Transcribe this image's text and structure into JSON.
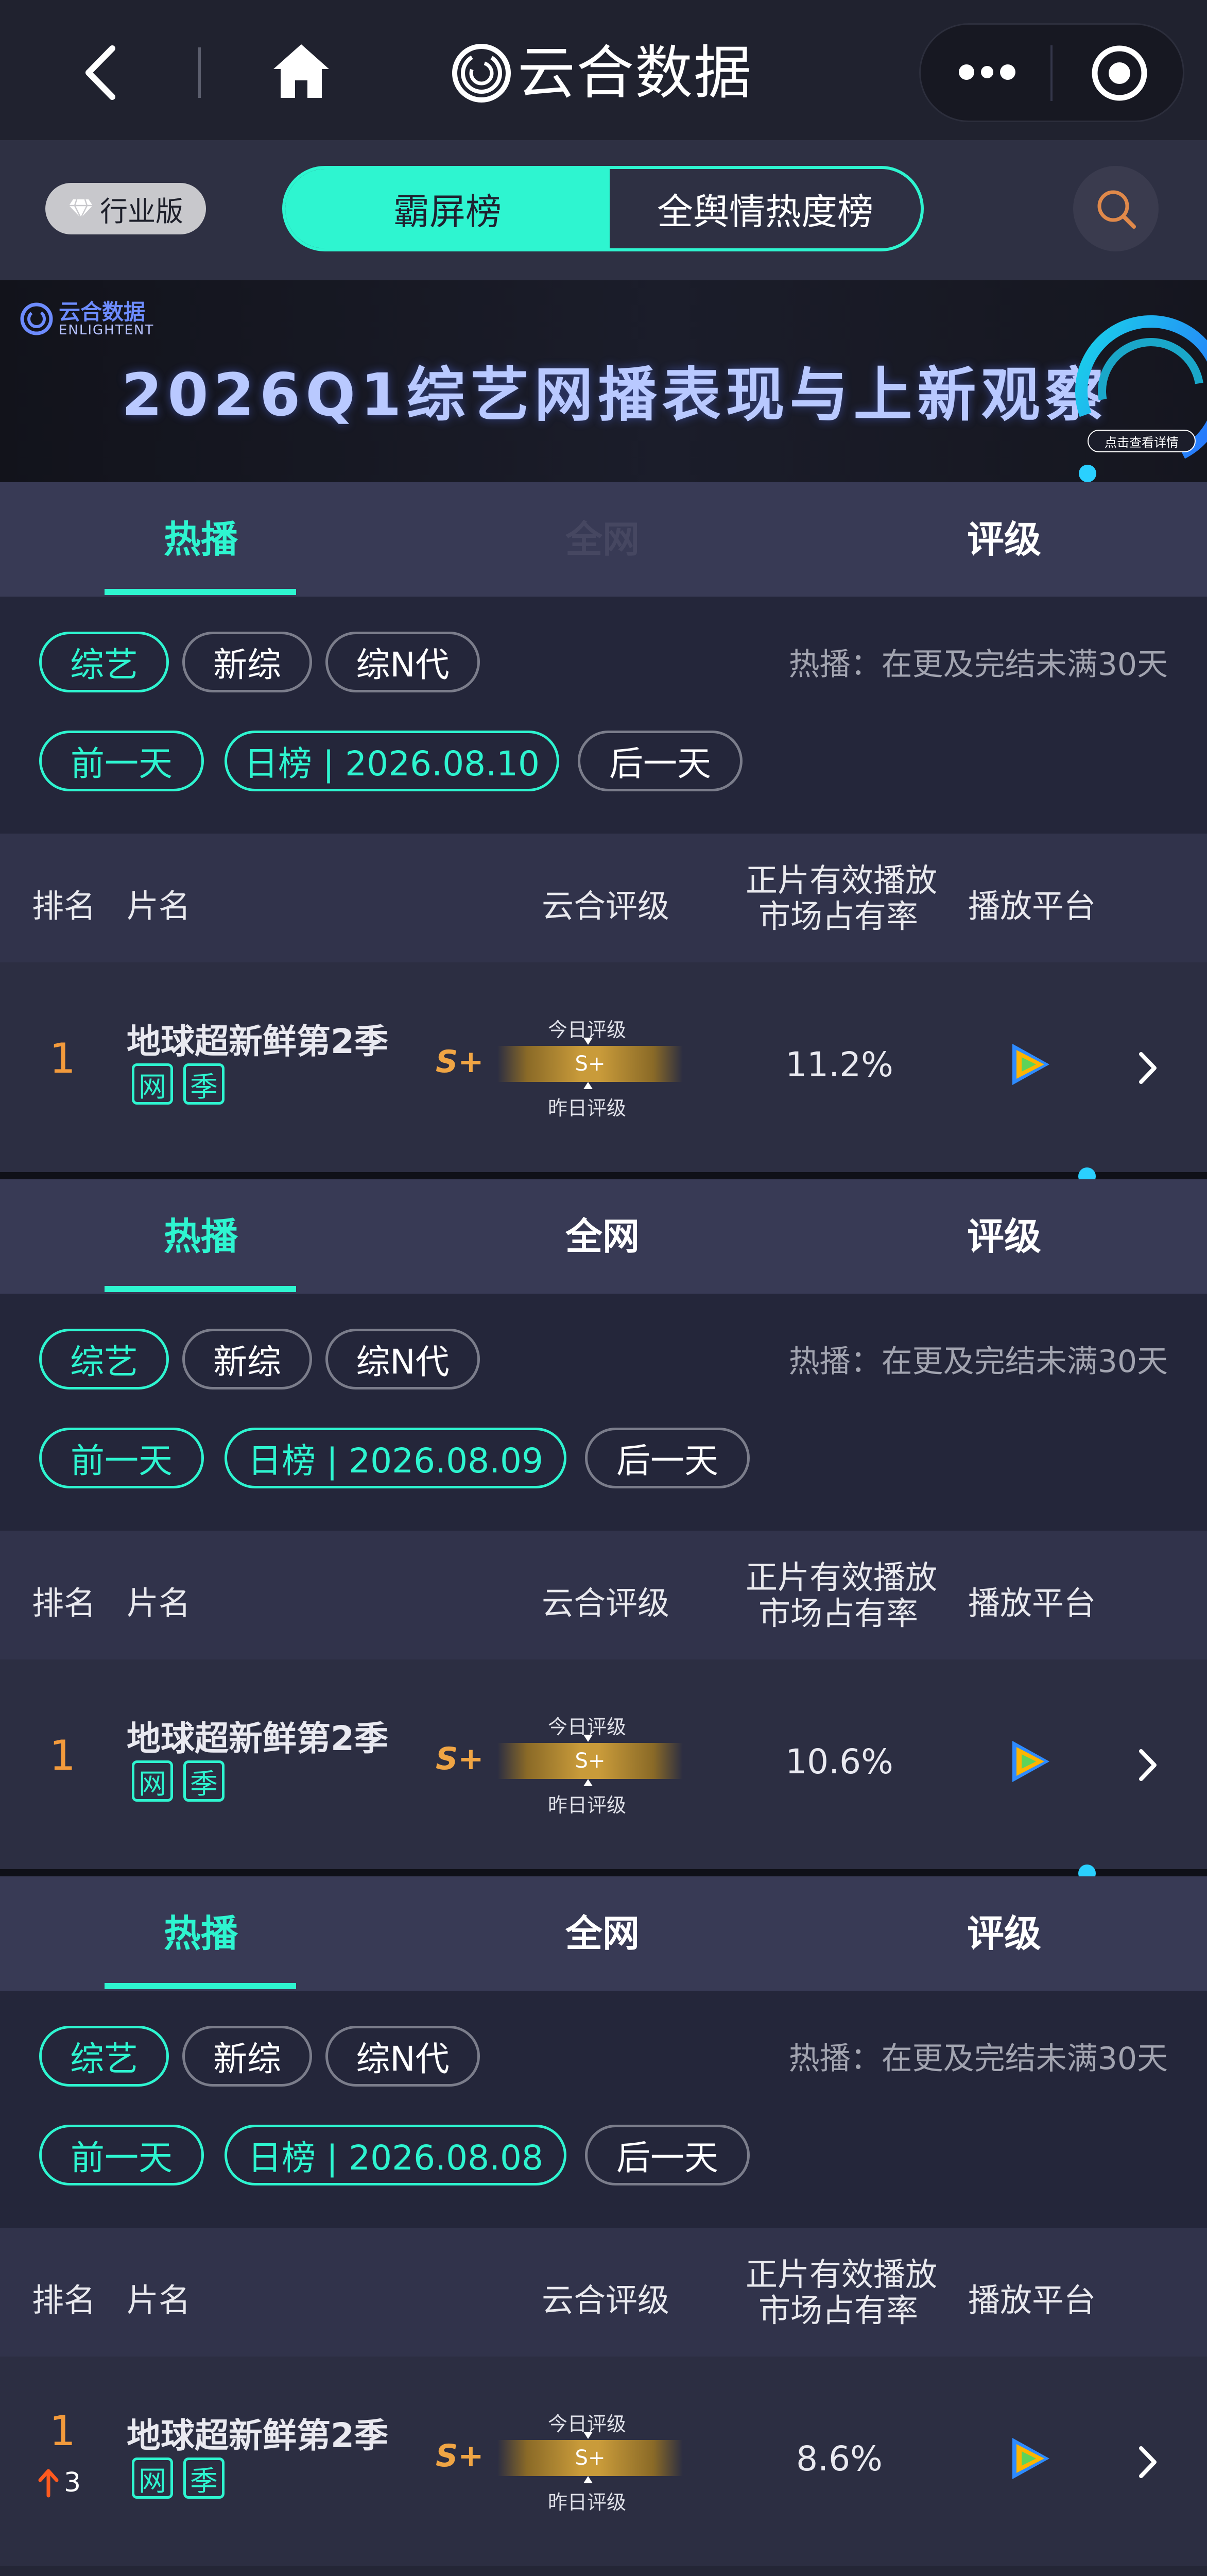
{
  "nav": {
    "back_icon": "chevron-left-icon",
    "home_icon": "home-icon",
    "app_logo_icon": "yunhe-logo-icon",
    "app_title": "云合数据",
    "more_icon": "more-dots-icon",
    "close_icon": "target-circle-icon"
  },
  "filterbar": {
    "edition_label": "行业版",
    "edition_icon": "diamond-icon",
    "segments": [
      "霸屏榜",
      "全舆情热度榜"
    ],
    "active_segment": "霸屏榜",
    "search_icon": "search-icon"
  },
  "banner": {
    "brand_name": "云合数据",
    "brand_sub": "ENLIGHTENT",
    "title": "2026Q1综艺网播表现与上新观察",
    "detail_button": "点击查看详情"
  },
  "sections": [
    {
      "tabs": [
        "热播",
        "全网",
        "评级"
      ],
      "active_tab": "热播",
      "middle_tab_visible": false,
      "filters": [
        "综艺",
        "新综",
        "综N代"
      ],
      "active_filter": "综艺",
      "note": "热播：在更及完结未满30天",
      "prev_label": "前一天",
      "date_label": "日榜 | 2026.08.10",
      "next_label": "后一天",
      "headers": {
        "rank": "排名",
        "title": "片名",
        "rating": "云合评级",
        "share_line1": "正片有效播放",
        "share_line2": "市场占有率",
        "platform": "播放平台"
      },
      "row": {
        "rank": "1",
        "rank_change": "",
        "title": "地球超新鲜第2季",
        "tags": [
          "网",
          "季"
        ],
        "grade": "S+",
        "today_label": "今日评级",
        "bar_grade": "S+",
        "yesterday_label": "昨日评级",
        "share": "11.2%",
        "platform_icon": "tencent-video-icon",
        "arrow_icon": "chevron-right-icon"
      }
    },
    {
      "tabs": [
        "热播",
        "全网",
        "评级"
      ],
      "active_tab": "热播",
      "middle_tab_visible": true,
      "filters": [
        "综艺",
        "新综",
        "综N代"
      ],
      "active_filter": "综艺",
      "note": "热播：在更及完结未满30天",
      "prev_label": "前一天",
      "date_label": "日榜 | 2026.08.09",
      "next_label": "后一天",
      "headers": {
        "rank": "排名",
        "title": "片名",
        "rating": "云合评级",
        "share_line1": "正片有效播放",
        "share_line2": "市场占有率",
        "platform": "播放平台"
      },
      "row": {
        "rank": "1",
        "rank_change": "",
        "title": "地球超新鲜第2季",
        "tags": [
          "网",
          "季"
        ],
        "grade": "S+",
        "today_label": "今日评级",
        "bar_grade": "S+",
        "yesterday_label": "昨日评级",
        "share": "10.6%",
        "platform_icon": "tencent-video-icon",
        "arrow_icon": "chevron-right-icon"
      }
    },
    {
      "tabs": [
        "热播",
        "全网",
        "评级"
      ],
      "active_tab": "热播",
      "middle_tab_visible": true,
      "filters": [
        "综艺",
        "新综",
        "综N代"
      ],
      "active_filter": "综艺",
      "note": "热播：在更及完结未满30天",
      "prev_label": "前一天",
      "date_label": "日榜 | 2026.08.08",
      "next_label": "后一天",
      "headers": {
        "rank": "排名",
        "title": "片名",
        "rating": "云合评级",
        "share_line1": "正片有效播放",
        "share_line2": "市场占有率",
        "platform": "播放平台"
      },
      "row": {
        "rank": "1",
        "rank_change": "3",
        "title": "地球超新鲜第2季",
        "tags": [
          "网",
          "季"
        ],
        "grade": "S+",
        "today_label": "今日评级",
        "bar_grade": "S+",
        "yesterday_label": "昨日评级",
        "share": "8.6%",
        "platform_icon": "tencent-video-icon",
        "arrow_icon": "chevron-right-icon"
      }
    }
  ],
  "colors": {
    "accent": "#2ef5d0",
    "rank": "#f29a3c",
    "grade": "#f0a544",
    "rise_arrow": "#ff5a1f",
    "background": "#242636"
  }
}
